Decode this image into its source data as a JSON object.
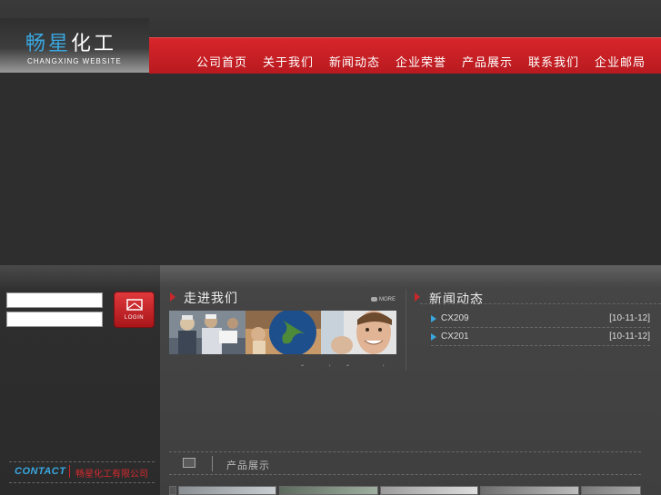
{
  "logo": {
    "title_part1": "畅星",
    "title_part2": "化工",
    "subtitle": "CHANGXING WEBSITE"
  },
  "nav": {
    "items": [
      "公司首页",
      "关于我们",
      "新闻动态",
      "企业荣誉",
      "产品展示",
      "联系我们",
      "企业邮局"
    ]
  },
  "login": {
    "button_label": "LOGIN"
  },
  "contact": {
    "label": "CONTACT",
    "company": "畅星化工有限公司"
  },
  "about": {
    "title": "走进我们",
    "more_label": "MORE",
    "dots": [
      "“",
      "'",
      "“",
      "'"
    ]
  },
  "news": {
    "title": "新闻动态",
    "items": [
      {
        "title": "CX209",
        "date": "[10-11-12]"
      },
      {
        "title": "CX201",
        "date": "[10-11-12]"
      }
    ]
  },
  "products": {
    "title": "产品展示"
  },
  "colors": {
    "nav_red": "#c8272c",
    "accent_blue": "#39a7e0",
    "background": "#2c2c2c"
  }
}
